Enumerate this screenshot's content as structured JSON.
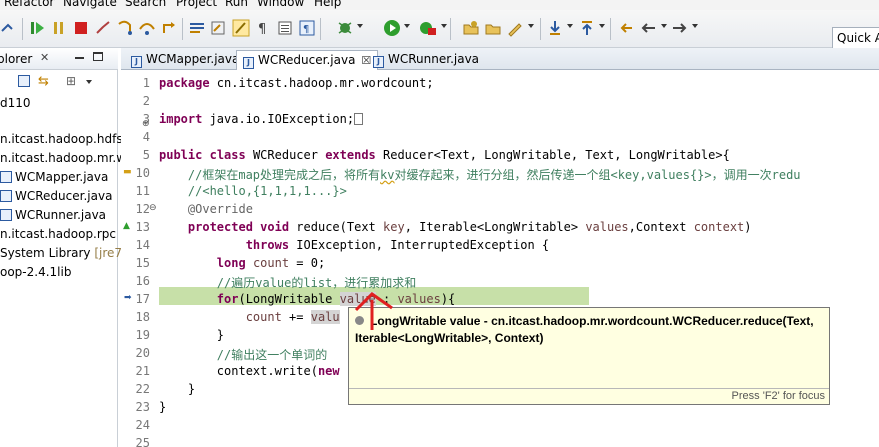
{
  "menu": {
    "items": [
      "Refactor",
      "Navigate",
      "Search",
      "Project",
      "Run",
      "Window",
      "Help"
    ]
  },
  "toolbar": {
    "icons": [
      "save-icon",
      "debug-icon",
      "run-icon",
      "pause-icon",
      "stop-icon",
      "step-into-icon",
      "step-over-icon",
      "step-return-icon",
      "drop-to-frame-icon",
      "use-step-filters-icon",
      "toggle-mark-icon",
      "highlight-icon",
      "show-whitespace-icon",
      "block-select-icon",
      "terminate-icon",
      "new-java-project-icon",
      "run-menu-icon",
      "external-tools-icon",
      "new-class-icon",
      "open-type-icon",
      "search-icon",
      "pencil-icon",
      "annotation-next-icon",
      "annotation-prev-icon",
      "back-icon",
      "forward-icon"
    ],
    "quick_access": "Quick Ac"
  },
  "explorer": {
    "tab_title": "plorer",
    "items": [
      {
        "label": "d110",
        "icon": "project-icon"
      },
      {
        "label": "n.itcast.hadoop.hdfs",
        "icon": "package-icon"
      },
      {
        "label": "n.itcast.hadoop.mr.w",
        "icon": "package-icon"
      },
      {
        "label": "WCMapper.java",
        "icon": "java-file-icon"
      },
      {
        "label": "WCReducer.java",
        "icon": "java-file-icon"
      },
      {
        "label": "WCRunner.java",
        "icon": "java-file-icon"
      },
      {
        "label": "n.itcast.hadoop.rpc",
        "icon": "package-icon"
      },
      {
        "label": "System Library",
        "suffix": "[jre7]",
        "icon": "library-icon"
      },
      {
        "label": "oop-2.4.1lib",
        "icon": "library-icon"
      }
    ]
  },
  "editor": {
    "tabs": [
      {
        "label": "WCMapper.java",
        "active": false
      },
      {
        "label": "WCReducer.java",
        "active": true,
        "close": "☒"
      },
      {
        "label": "WCRunner.java",
        "active": false
      }
    ],
    "line_numbers": [
      "1",
      "2",
      "3",
      "4",
      "5",
      "6",
      "10",
      "11",
      "12",
      "13",
      "14",
      "15",
      "16",
      "17",
      "18",
      "19",
      "20",
      "21",
      "22",
      "23",
      "24",
      "25"
    ],
    "lines": [
      "package cn.itcast.hadoop.mr.wordcount;",
      "",
      "import java.io.IOException;",
      "",
      "public class WCReducer extends Reducer<Text, LongWritable, Text, LongWritable>{",
      "",
      "    //框架在map处理完成之后，将所有kv对缓存起来，进行分组，然后传递一个组<key,values{}>，调用一次reduce方法",
      "    //<hello,{1,1,1,1...}>",
      "    @Override",
      "    protected void reduce(Text key, Iterable<LongWritable> values,Context context)",
      "            throws IOException, InterruptedException {",
      "        long count = 0;",
      "        //遍历value的list，进行累加求和",
      "        for(LongWritable value : values){",
      "            count += value.get();",
      "        }",
      "        //输出这一个单词的统计结果",
      "        context.write(new Text(key), new LongWritable(count));",
      "    }",
      "}",
      "",
      ""
    ],
    "visible_text": {
      "l1_kw": "package",
      "l1_rest": " cn.itcast.hadoop.mr.wordcount;",
      "l3_kw": "import",
      "l3_rest": " java.io.IOException;",
      "l5_kw1": "public",
      "l5_kw2": "class",
      "l5_mid": " WCReducer ",
      "l5_kw3": "extends",
      "l5_rest": " Reducer<Text, LongWritable, Text, LongWritable>{",
      "l10_a": "    //框架在map处理完成之后，将所有",
      "l10_kv": "kv",
      "l10_b": "对缓存起来，进行分组，然后传递一个组<key,values{}>，调用一次redu",
      "l11": "    //<hello,{1,1,1,1...}>",
      "l12": "    @Override",
      "l13_kw1": "protected",
      "l13_kw2": "void",
      "l13_a": " reduce(Text ",
      "l13_key": "key",
      "l13_b": ", Iterable<LongWritable> ",
      "l13_values": "values",
      "l13_c": ",Context ",
      "l13_ctx": "context",
      "l13_d": ")",
      "l14_kw": "throws",
      "l14_rest": " IOException, InterruptedException {",
      "l15_kw": "long",
      "l15_var": "count",
      "l15_rest": " = 0;",
      "l16": "        //遍历value的list，进行累加求和",
      "l17_kw": "for",
      "l17_a": "(LongWritable ",
      "l17_var": "value",
      "l17_b": " : ",
      "l17_vals": "values",
      "l17_c": "){",
      "l18_var": "count",
      "l18_rest": " += ",
      "l18_val": "valu",
      "l19": "        }",
      "l20": "        //输出这一个单词的",
      "l21_a": "        context.write(",
      "l21_kw": "new",
      "l22": "    }",
      "l23": "}"
    }
  },
  "tooltip": {
    "text": "LongWritable value - cn.itcast.hadoop.mr.wordcount.WCReducer.reduce(Text, Iterable<LongWritable>, Context)",
    "footer": "Press 'F2' for focus"
  },
  "colors": {
    "keyword": "#7f0055",
    "comment": "#3f7f5f",
    "annotation": "#646464",
    "variable": "#6a3e3e",
    "current_line_highlight": "#c7e0a8",
    "tooltip_bg": "#ffffe1",
    "arrow": "#e02020"
  }
}
